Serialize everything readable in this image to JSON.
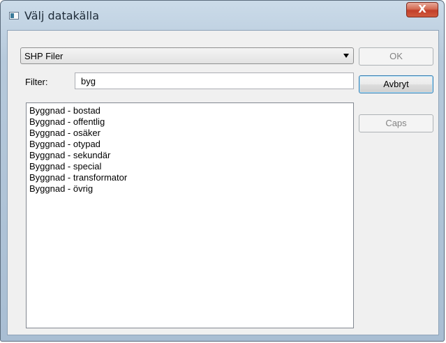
{
  "window": {
    "title": "Välj datakälla",
    "close_label": "X"
  },
  "source_select": {
    "selected": "SHP Filer"
  },
  "filter": {
    "label": "Filter:",
    "value": "byg"
  },
  "results": [
    "Byggnad - bostad",
    "Byggnad - offentlig",
    "Byggnad - osäker",
    "Byggnad - otypad",
    "Byggnad - sekundär",
    "Byggnad - special",
    "Byggnad - transformator",
    "Byggnad - övrig"
  ],
  "buttons": {
    "ok": "OK",
    "cancel": "Avbryt",
    "caps": "Caps"
  },
  "icons": {
    "app": "window-app-icon",
    "close": "close-icon",
    "dropdown": "chevron-down-icon"
  }
}
